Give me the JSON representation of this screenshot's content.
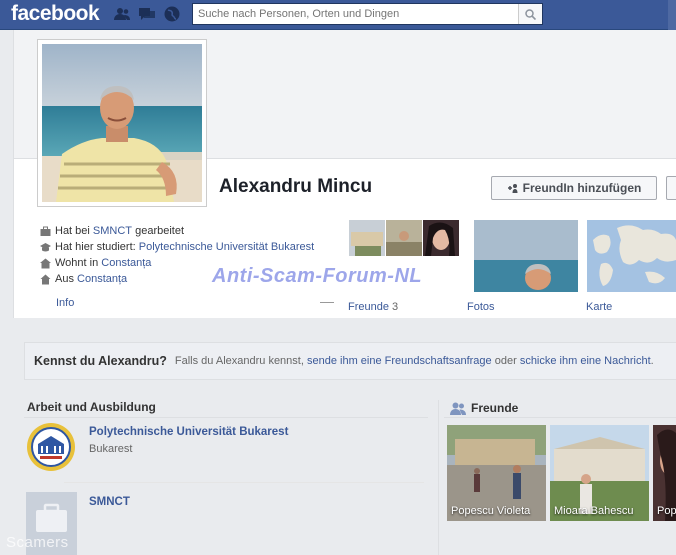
{
  "topbar": {
    "logo": "facebook",
    "search_placeholder": "Suche nach Personen, Orten und Dingen",
    "icons": [
      "friends-icon",
      "messages-icon",
      "globe-icon",
      "search-icon"
    ]
  },
  "profile": {
    "name": "Alexandru Mincu",
    "add_friend_label": "FreundIn hinzufügen"
  },
  "info": {
    "work_prefix": "Hat bei",
    "work_place": "SMNCT",
    "work_suffix": "gearbeitet",
    "study_prefix": "Hat hier studiert:",
    "study_place": "Polytechnische Universität Bukarest",
    "lives_prefix": "Wohnt in",
    "lives_place": "Constanța",
    "from_prefix": "Aus",
    "from_place": "Constanța",
    "info_link": "Info"
  },
  "media": {
    "friends_label": "Freunde",
    "friends_count": "3",
    "photos_label": "Fotos",
    "map_label": "Karte"
  },
  "watermark": "Anti-Scam-Forum-NL",
  "know_bar": {
    "title": "Kennst du Alexandru?",
    "text_1": "Falls du Alexandru kennst,",
    "link_1": "sende ihm eine Freundschaftsanfrage",
    "text_2": "oder",
    "link_2": "schicke ihm eine Nachricht",
    "text_3": "."
  },
  "work_education": {
    "heading": "Arbeit und Ausbildung",
    "items": [
      {
        "name": "Polytechnische Universität Bukarest",
        "sub": "Bukarest"
      },
      {
        "name": "SMNCT",
        "sub": ""
      }
    ]
  },
  "friends_box": {
    "heading": "Freunde",
    "items": [
      {
        "name": "Popescu Violeta"
      },
      {
        "name": "Mioara Bahescu"
      },
      {
        "name": "Popo"
      }
    ]
  },
  "bottom_watermark": "Scamers",
  "colors": {
    "brand": "#3b5998",
    "link": "#3b5998",
    "watermark": "#8c96e6"
  }
}
